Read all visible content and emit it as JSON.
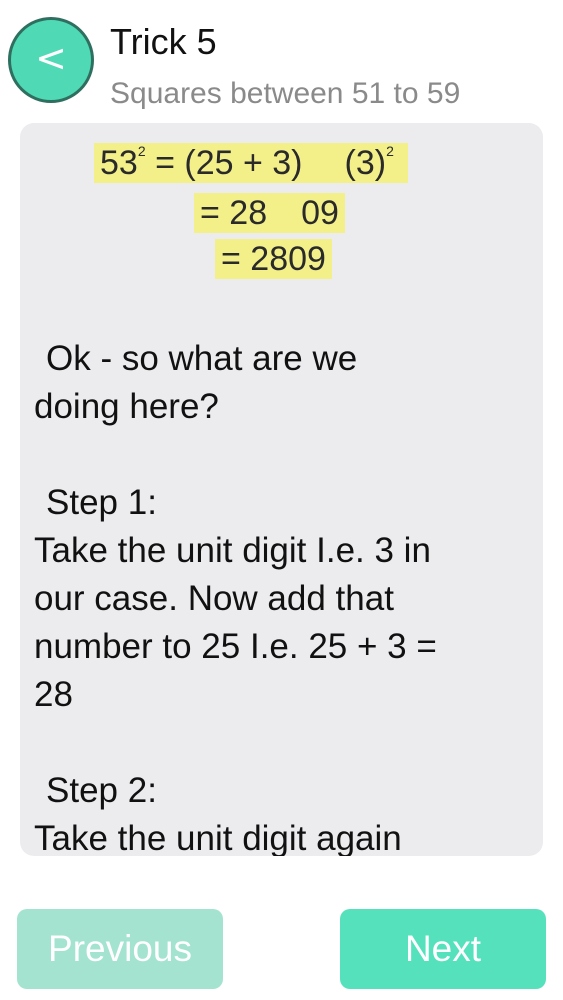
{
  "header": {
    "back_label": "<",
    "back_icon": "chevron-left-icon",
    "title": "Trick 5",
    "subtitle": "Squares between 51 to 59"
  },
  "formula": {
    "line1_base": "53",
    "line1_exp": "2",
    "line1_mid": " = (25 + 3)",
    "line1_term": "(3)",
    "line1_term_exp": "2",
    "line2_part1": "= 28",
    "line2_part2": "09",
    "line3": "= 2809",
    "highlight_color": "#f3f08a"
  },
  "explanation": {
    "intro_line1": "Ok - so what are we",
    "intro_line2": "doing here?",
    "step1_heading": "Step 1:",
    "step1_line1": "Take the unit digit I.e. 3 in",
    "step1_line2": "our case. Now add that",
    "step1_line3": "number to 25 I.e. 25 + 3 =",
    "step1_line4": "28",
    "step2_heading": "Step 2:",
    "step2_line1": "Take the unit digit again"
  },
  "footer": {
    "previous_label": "Previous",
    "next_label": "Next",
    "previous_color": "#a3e3cf",
    "next_color": "#56e1bd"
  }
}
